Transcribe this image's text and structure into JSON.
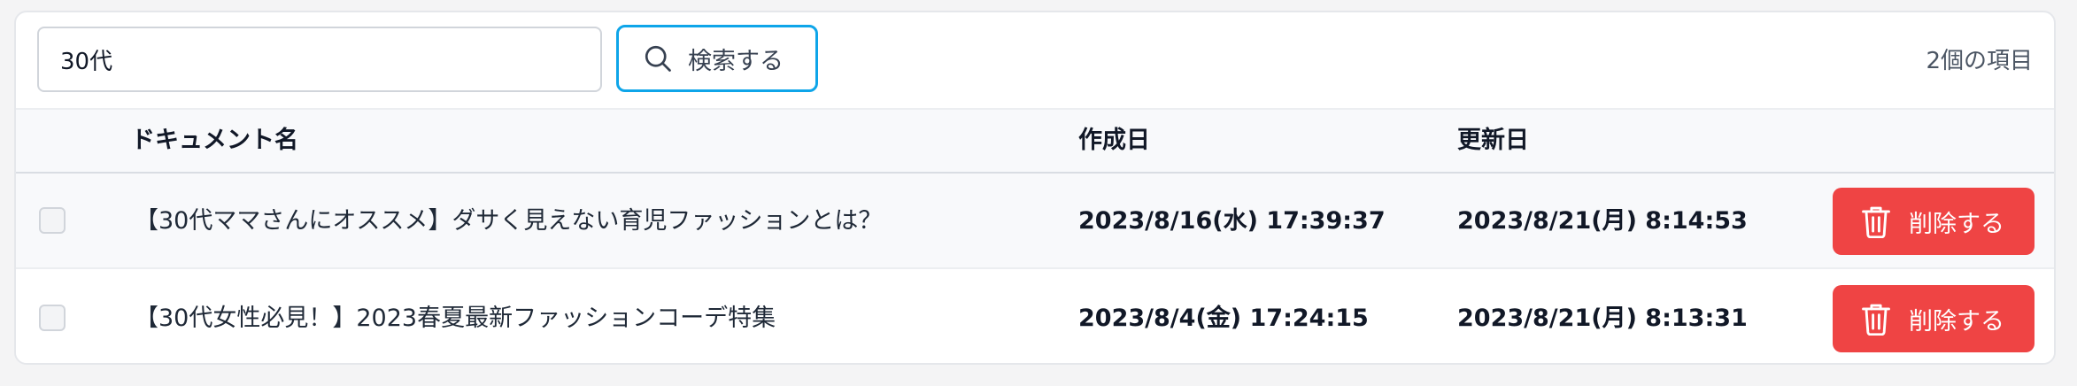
{
  "search": {
    "value": "30代",
    "button_label": "検索する"
  },
  "item_count": "2個の項目",
  "table": {
    "headers": {
      "name": "ドキュメント名",
      "created": "作成日",
      "updated": "更新日"
    },
    "rows": [
      {
        "name": "【30代ママさんにオススメ】ダサく見えない育児ファッションとは？",
        "created": "2023/8/16(水) 17:39:37",
        "updated": "2023/8/21(月) 8:14:53",
        "delete_label": "削除する"
      },
      {
        "name": "【30代女性必見！】2023春夏最新ファッションコーデ特集",
        "created": "2023/8/4(金) 17:24:15",
        "updated": "2023/8/21(月) 8:13:31",
        "delete_label": "削除する"
      }
    ]
  },
  "colors": {
    "accent": "#0ea5e9",
    "danger": "#ef4444"
  }
}
